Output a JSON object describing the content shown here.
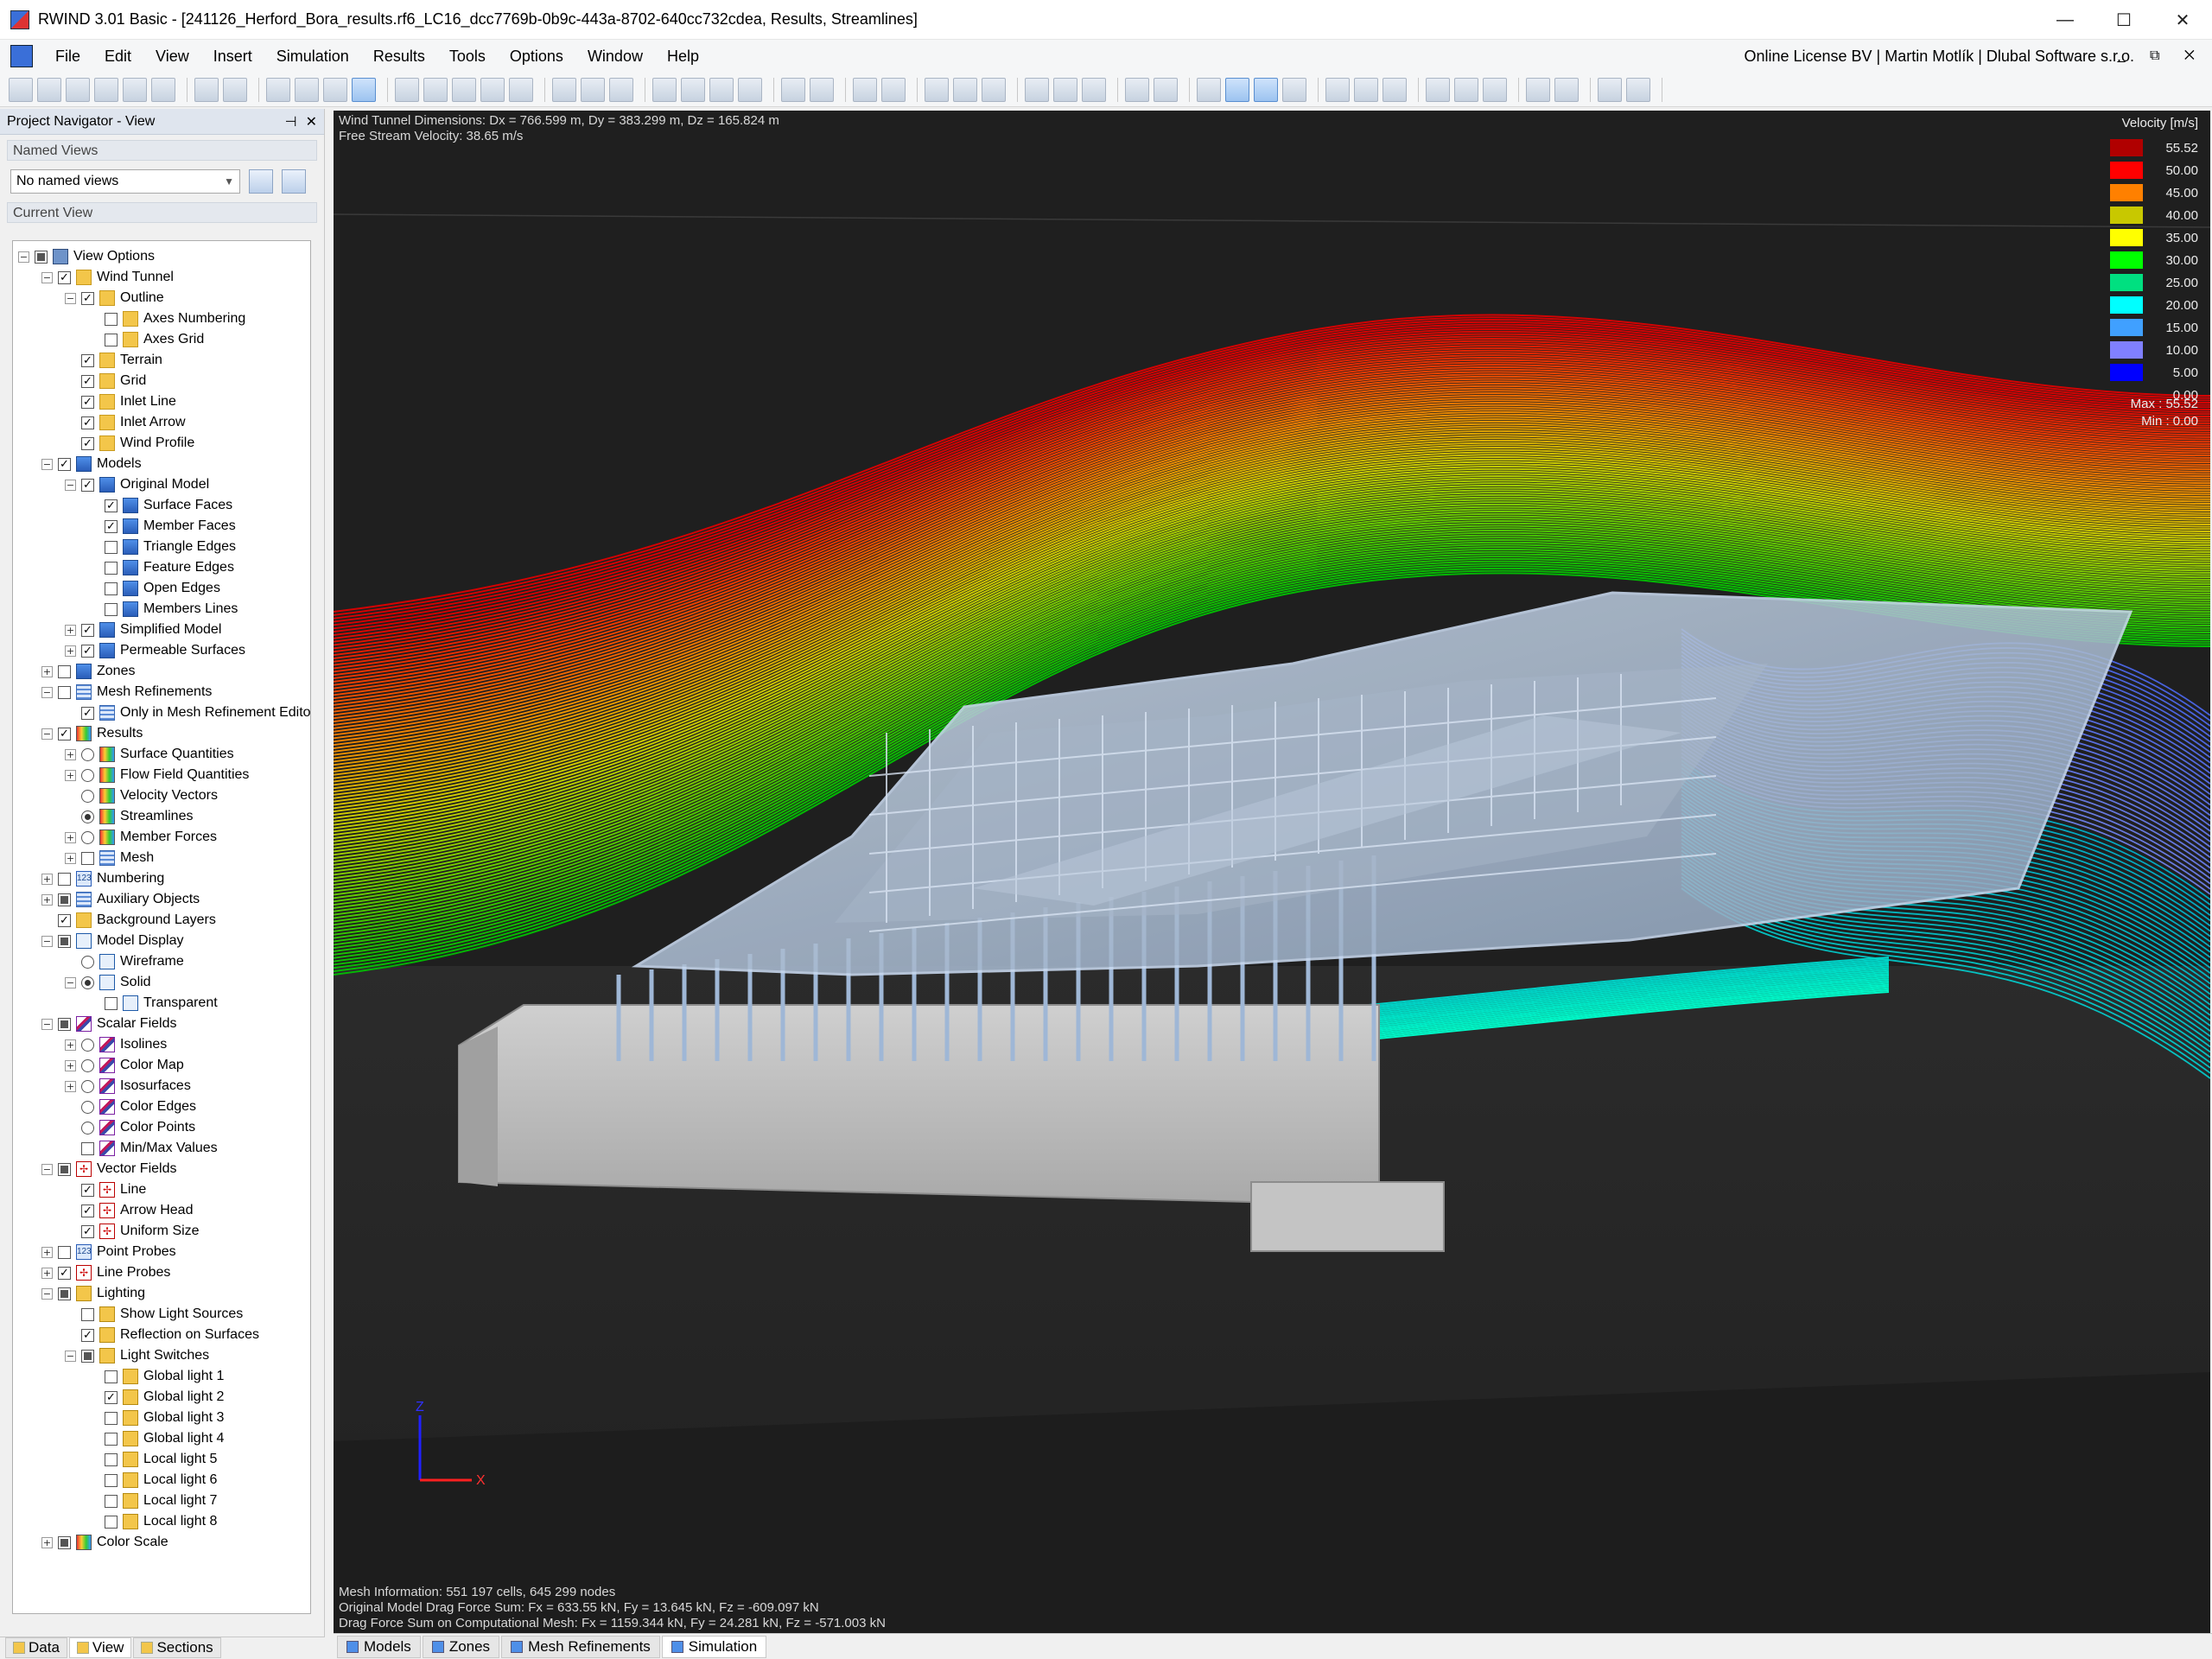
{
  "window": {
    "title": "RWIND 3.01 Basic - [241126_Herford_Bora_results.rf6_LC16_dcc7769b-0b9c-443a-8702-640cc732cdea, Results, Streamlines]",
    "minimize": "—",
    "maximize": "☐",
    "close": "✕"
  },
  "menu": {
    "items": [
      "File",
      "Edit",
      "View",
      "Insert",
      "Simulation",
      "Results",
      "Tools",
      "Options",
      "Window",
      "Help"
    ],
    "license": "Online License BV | Martin Motlík | Dlubal Software s.r.o.",
    "mdi": "_ ⧉ ✕"
  },
  "navigator": {
    "title": "Project Navigator - View",
    "pin": "⊣",
    "close": "✕",
    "named_views_label": "Named Views",
    "named_views_value": "No named views",
    "current_view_label": "Current View"
  },
  "tree": [
    {
      "label": "View Options",
      "level": 0,
      "exp": "-",
      "ctl": "partial",
      "icon": "view"
    },
    {
      "label": "Wind Tunnel",
      "level": 1,
      "exp": "-",
      "ctl": "checked",
      "icon": "folder"
    },
    {
      "label": "Outline",
      "level": 2,
      "exp": "-",
      "ctl": "checked",
      "icon": "folder"
    },
    {
      "label": "Axes Numbering",
      "level": 3,
      "exp": "",
      "ctl": "unchecked",
      "icon": "folder"
    },
    {
      "label": "Axes Grid",
      "level": 3,
      "exp": "",
      "ctl": "unchecked",
      "icon": "folder"
    },
    {
      "label": "Terrain",
      "level": 2,
      "exp": "",
      "ctl": "checked",
      "icon": "folder"
    },
    {
      "label": "Grid",
      "level": 2,
      "exp": "",
      "ctl": "checked",
      "icon": "folder"
    },
    {
      "label": "Inlet Line",
      "level": 2,
      "exp": "",
      "ctl": "checked",
      "icon": "folder"
    },
    {
      "label": "Inlet Arrow",
      "level": 2,
      "exp": "",
      "ctl": "checked",
      "icon": "folder"
    },
    {
      "label": "Wind Profile",
      "level": 2,
      "exp": "",
      "ctl": "checked",
      "icon": "folder"
    },
    {
      "label": "Models",
      "level": 1,
      "exp": "-",
      "ctl": "checked",
      "icon": "model"
    },
    {
      "label": "Original Model",
      "level": 2,
      "exp": "-",
      "ctl": "checked",
      "icon": "model"
    },
    {
      "label": "Surface Faces",
      "level": 3,
      "exp": "",
      "ctl": "checked",
      "icon": "model"
    },
    {
      "label": "Member Faces",
      "level": 3,
      "exp": "",
      "ctl": "checked",
      "icon": "model"
    },
    {
      "label": "Triangle Edges",
      "level": 3,
      "exp": "",
      "ctl": "unchecked",
      "icon": "model"
    },
    {
      "label": "Feature Edges",
      "level": 3,
      "exp": "",
      "ctl": "unchecked",
      "icon": "model"
    },
    {
      "label": "Open Edges",
      "level": 3,
      "exp": "",
      "ctl": "unchecked",
      "icon": "model"
    },
    {
      "label": "Members Lines",
      "level": 3,
      "exp": "",
      "ctl": "unchecked",
      "icon": "model"
    },
    {
      "label": "Simplified Model",
      "level": 2,
      "exp": "+",
      "ctl": "checked",
      "icon": "model"
    },
    {
      "label": "Permeable Surfaces",
      "level": 2,
      "exp": "+",
      "ctl": "checked",
      "icon": "model"
    },
    {
      "label": "Zones",
      "level": 1,
      "exp": "+",
      "ctl": "unchecked",
      "icon": "model"
    },
    {
      "label": "Mesh Refinements",
      "level": 1,
      "exp": "-",
      "ctl": "unchecked",
      "icon": "grid"
    },
    {
      "label": "Only in Mesh Refinement Editor",
      "level": 2,
      "exp": "",
      "ctl": "checked",
      "icon": "grid"
    },
    {
      "label": "Results",
      "level": 1,
      "exp": "-",
      "ctl": "checked",
      "icon": "result"
    },
    {
      "label": "Surface Quantities",
      "level": 2,
      "exp": "+",
      "ctl": "radio",
      "icon": "result"
    },
    {
      "label": "Flow Field Quantities",
      "level": 2,
      "exp": "+",
      "ctl": "radio",
      "icon": "result"
    },
    {
      "label": "Velocity Vectors",
      "level": 2,
      "exp": "",
      "ctl": "radio",
      "icon": "result"
    },
    {
      "label": "Streamlines",
      "level": 2,
      "exp": "",
      "ctl": "radio-on",
      "icon": "result"
    },
    {
      "label": "Member Forces",
      "level": 2,
      "exp": "+",
      "ctl": "radio",
      "icon": "result"
    },
    {
      "label": "Mesh",
      "level": 2,
      "exp": "+",
      "ctl": "unchecked",
      "icon": "grid"
    },
    {
      "label": "Numbering",
      "level": 1,
      "exp": "+",
      "ctl": "unchecked",
      "icon": "num"
    },
    {
      "label": "Auxiliary Objects",
      "level": 1,
      "exp": "+",
      "ctl": "partial",
      "icon": "grid"
    },
    {
      "label": "Background Layers",
      "level": 1,
      "exp": "",
      "ctl": "checked",
      "icon": "folder"
    },
    {
      "label": "Model Display",
      "level": 1,
      "exp": "-",
      "ctl": "partial",
      "icon": "cube"
    },
    {
      "label": "Wireframe",
      "level": 2,
      "exp": "",
      "ctl": "radio",
      "icon": "cube"
    },
    {
      "label": "Solid",
      "level": 2,
      "exp": "-",
      "ctl": "radio-on",
      "icon": "cube"
    },
    {
      "label": "Transparent",
      "level": 3,
      "exp": "",
      "ctl": "unchecked",
      "icon": "cube"
    },
    {
      "label": "Scalar Fields",
      "level": 1,
      "exp": "-",
      "ctl": "partial",
      "icon": "scalar"
    },
    {
      "label": "Isolines",
      "level": 2,
      "exp": "+",
      "ctl": "radio",
      "icon": "scalar"
    },
    {
      "label": "Color Map",
      "level": 2,
      "exp": "+",
      "ctl": "radio",
      "icon": "scalar"
    },
    {
      "label": "Isosurfaces",
      "level": 2,
      "exp": "+",
      "ctl": "radio",
      "icon": "scalar"
    },
    {
      "label": "Color Edges",
      "level": 2,
      "exp": "",
      "ctl": "radio",
      "icon": "scalar"
    },
    {
      "label": "Color Points",
      "level": 2,
      "exp": "",
      "ctl": "radio",
      "icon": "scalar"
    },
    {
      "label": "Min/Max Values",
      "level": 2,
      "exp": "",
      "ctl": "unchecked",
      "icon": "scalar"
    },
    {
      "label": "Vector Fields",
      "level": 1,
      "exp": "-",
      "ctl": "partial",
      "icon": "vector"
    },
    {
      "label": "Line",
      "level": 2,
      "exp": "",
      "ctl": "checked",
      "icon": "vector"
    },
    {
      "label": "Arrow Head",
      "level": 2,
      "exp": "",
      "ctl": "checked",
      "icon": "vector"
    },
    {
      "label": "Uniform Size",
      "level": 2,
      "exp": "",
      "ctl": "checked",
      "icon": "vector"
    },
    {
      "label": "Point Probes",
      "level": 1,
      "exp": "+",
      "ctl": "unchecked",
      "icon": "num"
    },
    {
      "label": "Line Probes",
      "level": 1,
      "exp": "+",
      "ctl": "checked",
      "icon": "vector"
    },
    {
      "label": "Lighting",
      "level": 1,
      "exp": "-",
      "ctl": "partial",
      "icon": "light"
    },
    {
      "label": "Show Light Sources",
      "level": 2,
      "exp": "",
      "ctl": "unchecked",
      "icon": "light"
    },
    {
      "label": "Reflection on Surfaces",
      "level": 2,
      "exp": "",
      "ctl": "checked",
      "icon": "light"
    },
    {
      "label": "Light Switches",
      "level": 2,
      "exp": "-",
      "ctl": "partial",
      "icon": "light"
    },
    {
      "label": "Global light 1",
      "level": 3,
      "exp": "",
      "ctl": "unchecked",
      "icon": "light"
    },
    {
      "label": "Global light 2",
      "level": 3,
      "exp": "",
      "ctl": "checked",
      "icon": "light"
    },
    {
      "label": "Global light 3",
      "level": 3,
      "exp": "",
      "ctl": "unchecked",
      "icon": "light"
    },
    {
      "label": "Global light 4",
      "level": 3,
      "exp": "",
      "ctl": "unchecked",
      "icon": "light"
    },
    {
      "label": "Local light 5",
      "level": 3,
      "exp": "",
      "ctl": "unchecked",
      "icon": "light"
    },
    {
      "label": "Local light 6",
      "level": 3,
      "exp": "",
      "ctl": "unchecked",
      "icon": "light"
    },
    {
      "label": "Local light 7",
      "level": 3,
      "exp": "",
      "ctl": "unchecked",
      "icon": "light"
    },
    {
      "label": "Local light 8",
      "level": 3,
      "exp": "",
      "ctl": "unchecked",
      "icon": "light"
    },
    {
      "label": "Color Scale",
      "level": 1,
      "exp": "+",
      "ctl": "partial",
      "icon": "result"
    }
  ],
  "left_tabs": [
    "Data",
    "View",
    "Sections"
  ],
  "viewport": {
    "info_top_1": "Wind Tunnel Dimensions: Dx = 766.599 m, Dy = 383.299 m, Dz = 165.824 m",
    "info_top_2": "Free Stream Velocity: 38.65 m/s",
    "info_bottom_1": "Mesh Information: 551 197 cells, 645 299 nodes",
    "info_bottom_2": "Original Model Drag Force Sum: Fx = 633.55 kN, Fy = 13.645 kN, Fz = -609.097 kN",
    "info_bottom_3": "Drag Force Sum on Computational Mesh: Fx = 1159.344 kN, Fy = 24.281 kN, Fz = -571.003 kN",
    "axis_z": "Z",
    "axis_x": "X"
  },
  "legend": {
    "title": "Velocity [m/s]",
    "entries": [
      {
        "value": "55.52",
        "color": "#b00000"
      },
      {
        "value": "50.00",
        "color": "#ff0000"
      },
      {
        "value": "45.00",
        "color": "#ff8000"
      },
      {
        "value": "40.00",
        "color": "#c8c800"
      },
      {
        "value": "35.00",
        "color": "#ffff00"
      },
      {
        "value": "30.00",
        "color": "#00ff00"
      },
      {
        "value": "25.00",
        "color": "#00e080"
      },
      {
        "value": "20.00",
        "color": "#00ffff"
      },
      {
        "value": "15.00",
        "color": "#40a0ff"
      },
      {
        "value": "10.00",
        "color": "#8080ff"
      },
      {
        "value": "5.00",
        "color": "#0000ff"
      }
    ],
    "min_tick": "0.00",
    "max_label": "Max : 55.52",
    "min_label": "Min : 0.00"
  },
  "viewport_tabs": [
    "Models",
    "Zones",
    "Mesh Refinements",
    "Simulation"
  ]
}
